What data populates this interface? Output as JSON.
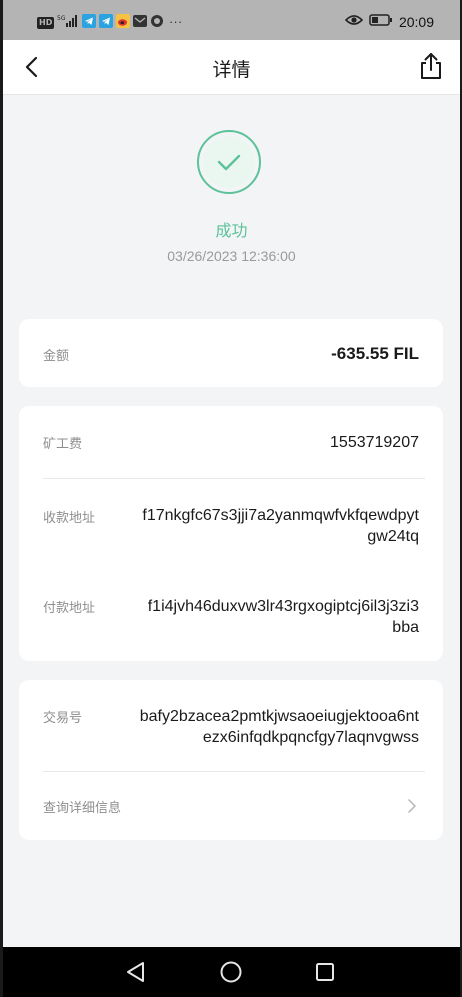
{
  "status_bar": {
    "hd_badge": "HD",
    "net_badge": "5G",
    "overflow": "···",
    "time": "20:09",
    "icons": [
      "signal-icon",
      "telegram-icon",
      "telegram-icon",
      "weibo-icon",
      "mail-icon",
      "app-icon",
      "eye-icon",
      "battery-icon"
    ]
  },
  "nav": {
    "title": "详情",
    "back_icon": "chevron-left-icon",
    "share_icon": "share-icon"
  },
  "status": {
    "label": "成功",
    "timestamp": "03/26/2023 12:36:00",
    "icon": "check-circle-icon",
    "color": "#5cc299"
  },
  "amount_card": {
    "label": "金额",
    "value": "-635.55 FIL"
  },
  "detail_card": {
    "fee_label": "矿工费",
    "fee_value": "1553719207",
    "to_label": "收款地址",
    "to_value": "f17nkgfc67s3jji7a2yanmqwfvkfqewdpytgw24tq",
    "from_label": "付款地址",
    "from_value": "f1i4jvh46duxvw3lr43rgxogiptcj6il3j3zi3bba"
  },
  "tx_card": {
    "hash_label": "交易号",
    "hash_value": "bafy2bzacea2pmtkjwsaoeiugjektooa6ntezx6infqdkpqncfgy7laqnvgwss",
    "more_label": "查询详细信息"
  },
  "system_nav": {
    "icons": [
      "back-triangle-icon",
      "home-circle-icon",
      "recents-square-icon"
    ]
  }
}
